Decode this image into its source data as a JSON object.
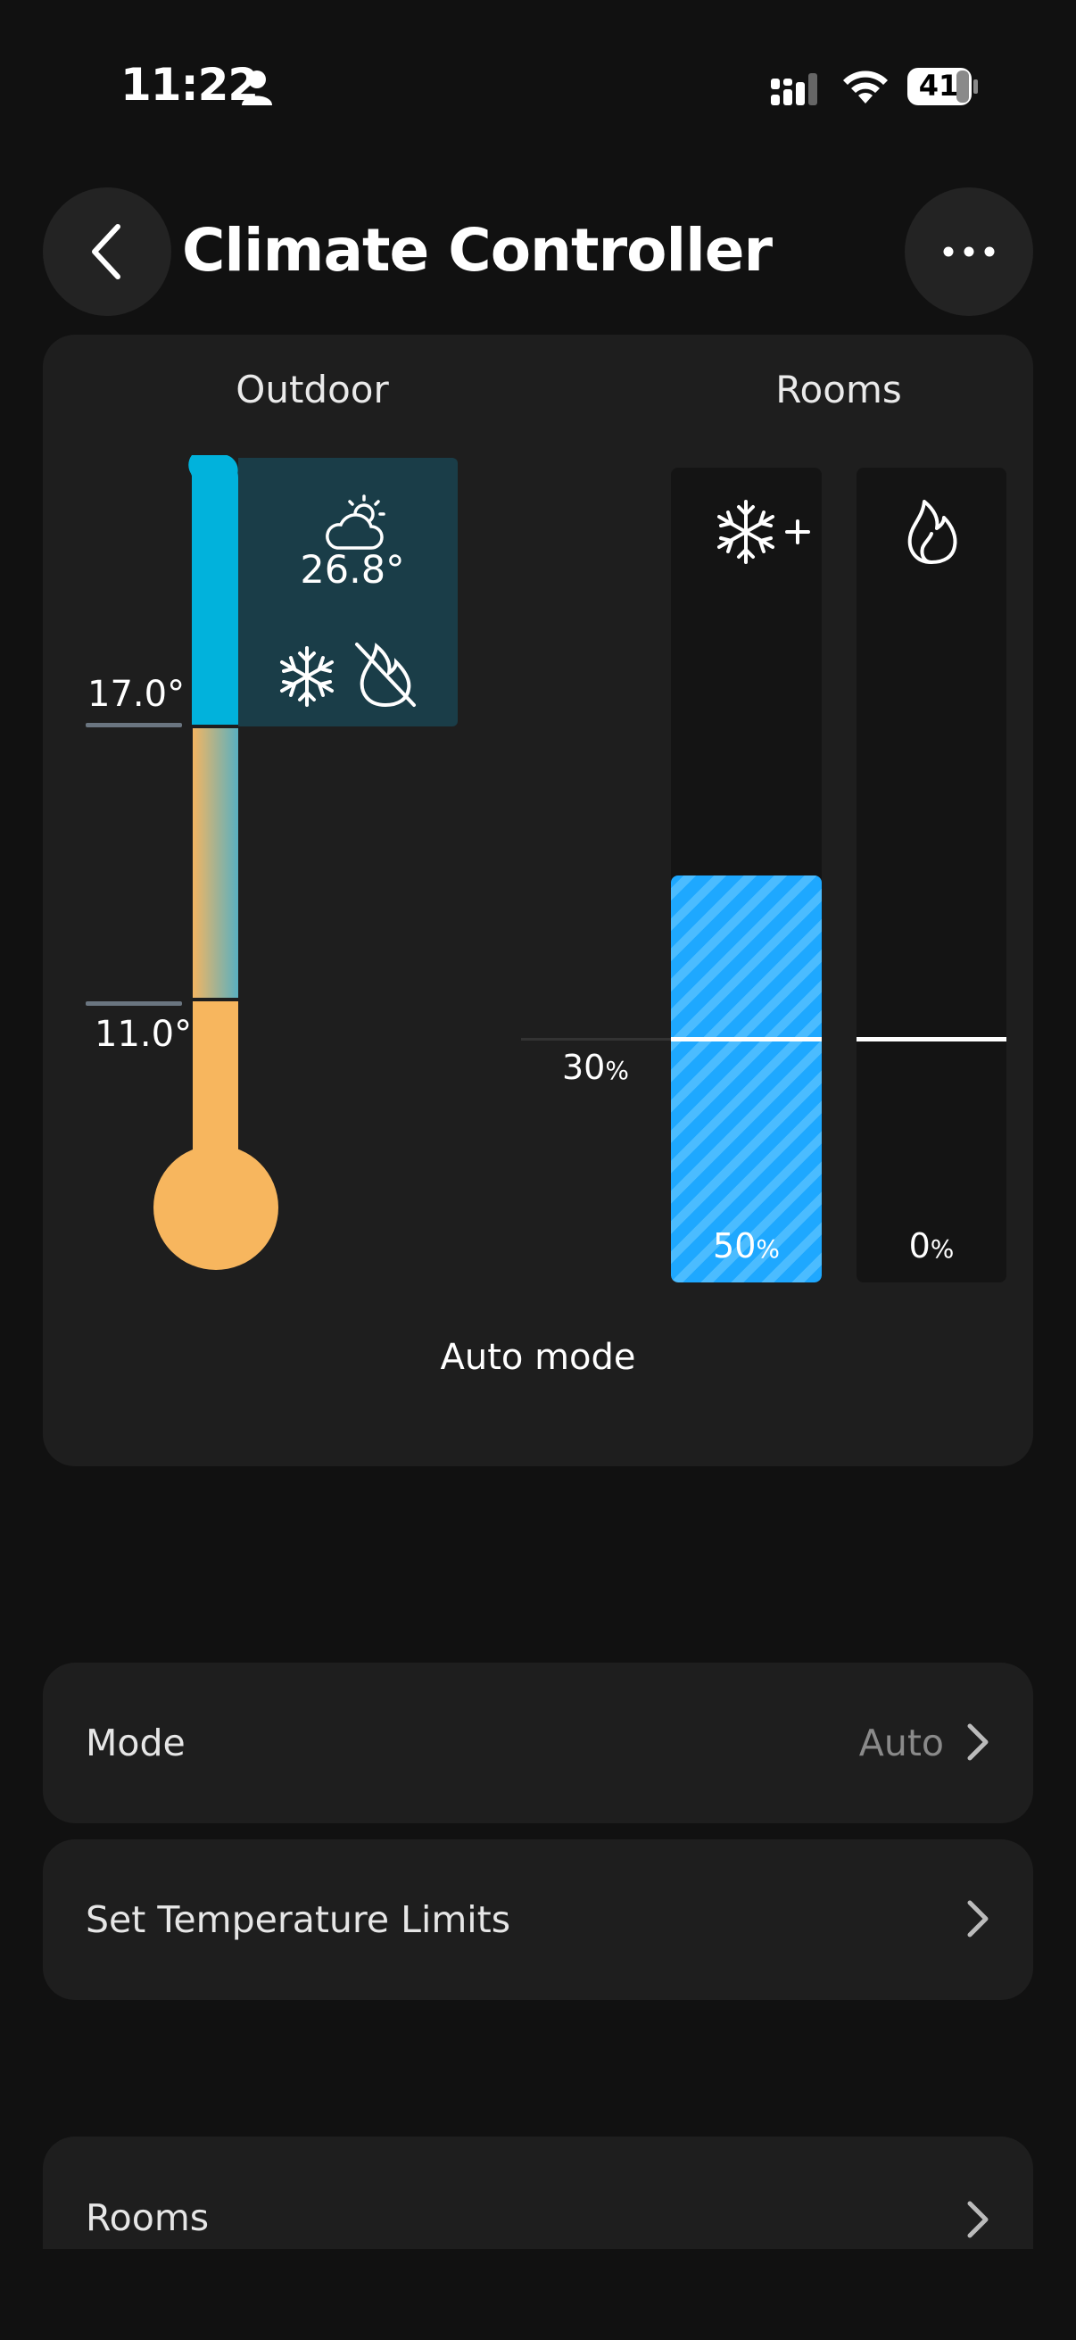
{
  "status_bar": {
    "time": "11:22",
    "battery": "41"
  },
  "header": {
    "title": "Climate Controller"
  },
  "climate": {
    "outdoor_label": "Outdoor",
    "rooms_label": "Rooms",
    "outdoor_temp": "26.8°",
    "upper_limit": "17.0°",
    "lower_limit": "11.0°",
    "threshold_value": "30",
    "threshold_unit": "%",
    "cooling_value": "50",
    "cooling_unit": "%",
    "cooling_level": 0.5,
    "heating_value": "0",
    "heating_unit": "%",
    "heating_level": 0,
    "mode_text": "Auto mode",
    "colors": {
      "cool": "#01b2dc",
      "warm": "#f7b65e",
      "bar_blue": "#22aaff",
      "panel": "#1a3d48"
    },
    "icons": [
      "partly-cloudy-sun-icon",
      "snowflake-icon",
      "heating-off-icon",
      "snowflake-plus-icon",
      "flame-icon"
    ]
  },
  "settings": {
    "mode_label": "Mode",
    "mode_value": "Auto",
    "limits_label": "Set Temperature Limits",
    "rooms_label": "Rooms"
  }
}
